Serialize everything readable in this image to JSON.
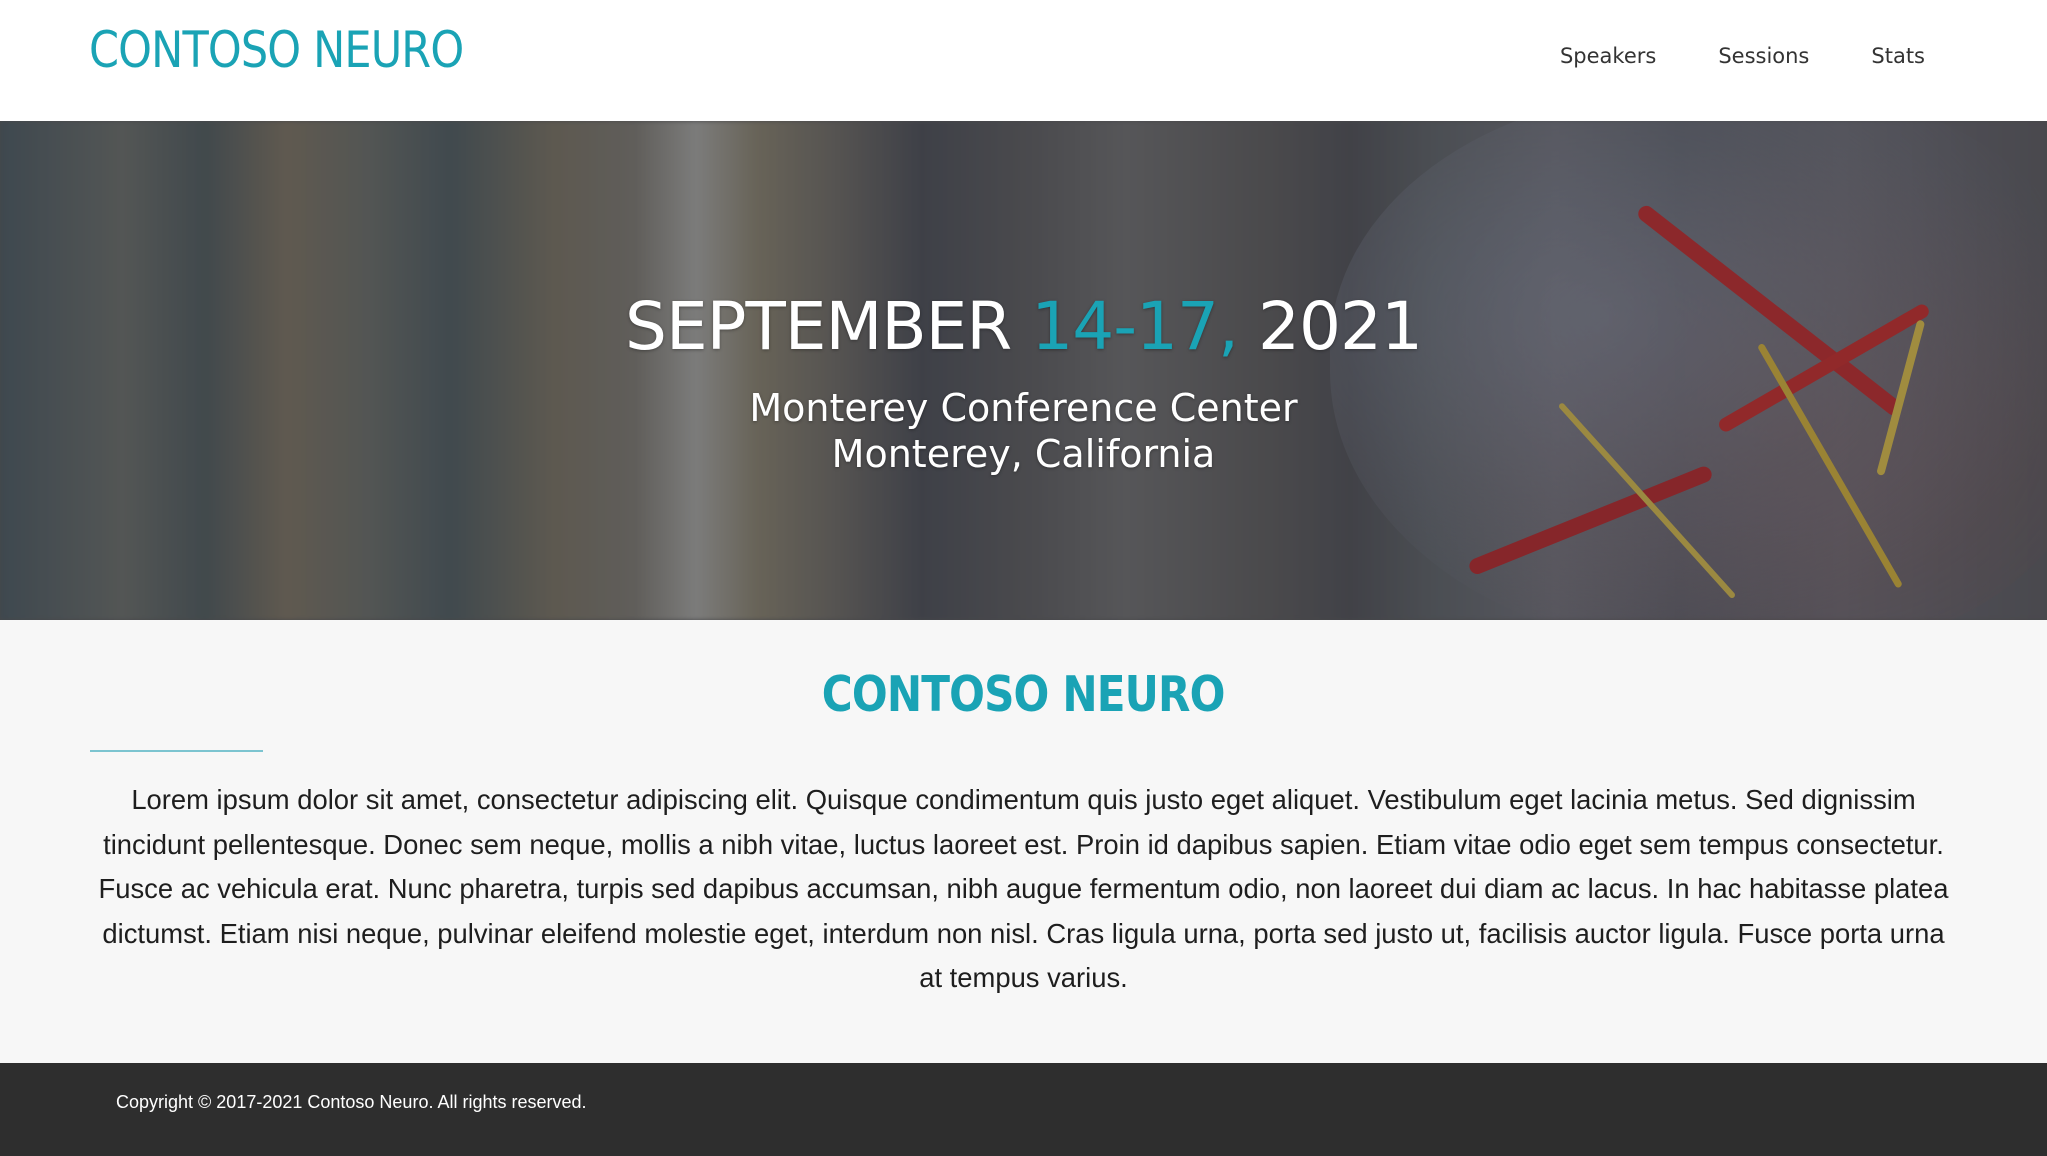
{
  "header": {
    "brand": "CONTOSO NEURO",
    "nav": [
      {
        "label": "Speakers"
      },
      {
        "label": "Sessions"
      },
      {
        "label": "Stats"
      }
    ]
  },
  "hero": {
    "date_month": "SEPTEMBER ",
    "date_days": "14-17, ",
    "date_year": "2021",
    "venue_line1": "Monterey Conference Center",
    "venue_line2": "Monterey, California"
  },
  "about": {
    "title": "CONTOSO NEURO",
    "body": "Lorem ipsum dolor sit amet, consectetur adipiscing elit. Quisque condimentum quis justo eget aliquet. Vestibulum eget lacinia metus. Sed dignissim tincidunt pellentesque. Donec sem neque, mollis a nibh vitae, luctus laoreet est. Proin id dapibus sapien. Etiam vitae odio eget sem tempus consectetur. Fusce ac vehicula erat. Nunc pharetra, turpis sed dapibus accumsan, nibh augue fermentum odio, non laoreet dui diam ac lacus. In hac habitasse platea dictumst. Etiam nisi neque, pulvinar eleifend molestie eget, interdum non nisl. Cras ligula urna, porta sed justo ut, facilisis auctor ligula. Fusce porta urna at tempus varius."
  },
  "footer": {
    "copyright": "Copyright © 2017-2021 Contoso Neuro. All rights reserved."
  },
  "colors": {
    "accent": "#1aa3b5",
    "footer_bg": "#2e2e2e",
    "page_bg": "#f7f7f7"
  }
}
